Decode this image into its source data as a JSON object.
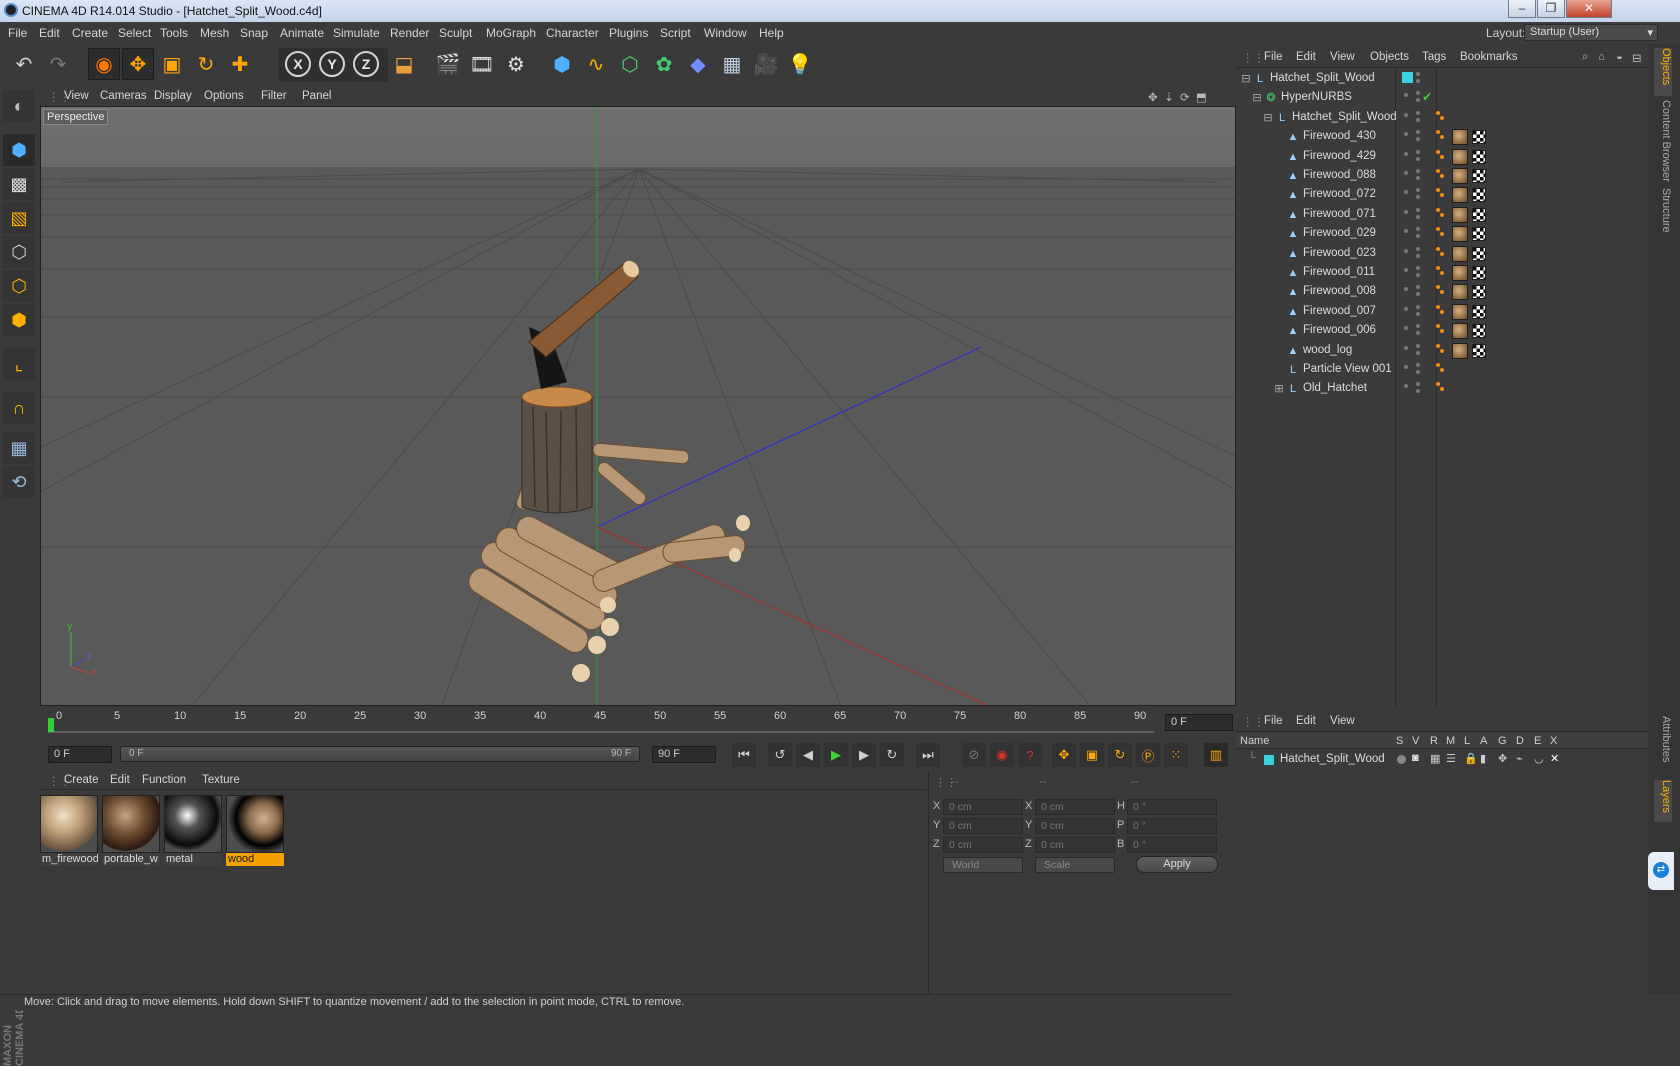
{
  "window": {
    "title": "CINEMA 4D R14.014 Studio - [Hatchet_Split_Wood.c4d]"
  },
  "menubar": {
    "items": [
      "File",
      "Edit",
      "Create",
      "Select",
      "Tools",
      "Mesh",
      "Snap",
      "Animate",
      "Simulate",
      "Render",
      "Sculpt",
      "MoGraph",
      "Character",
      "Plugins",
      "Script",
      "Window",
      "Help"
    ],
    "layout_label": "Layout:",
    "layout_value": "Startup (User)"
  },
  "toolbar": {
    "icons": [
      "undo-icon",
      "redo-icon",
      "live-selection-icon",
      "move-icon",
      "scale-icon",
      "rotate-icon",
      "create-object-icon",
      "x-axis-lock",
      "y-axis-lock",
      "z-axis-lock",
      "world-coordinates-icon",
      "render-view-icon",
      "render-picture-viewer-icon",
      "render-settings-icon",
      "cube-object-icon",
      "spline-icon",
      "nurbs-icon",
      "array-icon",
      "deformer-icon",
      "floor-icon",
      "camera-icon",
      "light-icon"
    ],
    "axis_x": "X",
    "axis_y": "Y",
    "axis_z": "Z"
  },
  "viewport": {
    "menu": [
      "View",
      "Cameras",
      "Display",
      "Options",
      "Filter",
      "Panel"
    ],
    "label": "Perspective"
  },
  "timeline": {
    "ticks": [
      "0",
      "5",
      "10",
      "15",
      "20",
      "25",
      "30",
      "35",
      "40",
      "45",
      "50",
      "55",
      "60",
      "65",
      "70",
      "75",
      "80",
      "85",
      "90"
    ],
    "current_frame": "0 F"
  },
  "transport": {
    "start": "0 F",
    "slider_left": "0 F",
    "slider_right": "90 F",
    "end": "90 F"
  },
  "materials": {
    "menu": [
      "Create",
      "Edit",
      "Function",
      "Texture"
    ],
    "items": [
      {
        "name": "m_firewood"
      },
      {
        "name": "portable_w"
      },
      {
        "name": "metal"
      },
      {
        "name": "wood"
      }
    ]
  },
  "coordinates": {
    "header": [
      "--",
      "--",
      "--"
    ],
    "rows": [
      {
        "a": "X",
        "av": "0 cm",
        "b": "X",
        "bv": "0 cm",
        "c": "H",
        "cv": "0 °"
      },
      {
        "a": "Y",
        "av": "0 cm",
        "b": "Y",
        "bv": "0 cm",
        "c": "P",
        "cv": "0 °"
      },
      {
        "a": "Z",
        "av": "0 cm",
        "b": "Z",
        "bv": "0 cm",
        "c": "B",
        "cv": "0 °"
      }
    ],
    "mode": "World",
    "scale": "Scale",
    "apply": "Apply"
  },
  "status": "Move: Click and drag to move elements. Hold down SHIFT to quantize movement / add to the selection in point mode, CTRL to remove.",
  "objects": {
    "menu": [
      "File",
      "Edit",
      "View",
      "Objects",
      "Tags",
      "Bookmarks"
    ],
    "rows": [
      {
        "name": "Hatchet_Split_Wood",
        "indent": 0,
        "icon": "null-icon"
      },
      {
        "name": "HyperNURBS",
        "indent": 1,
        "icon": "hypernurbs-icon"
      },
      {
        "name": "Hatchet_Split_Wood",
        "indent": 2,
        "icon": "null-icon"
      },
      {
        "name": "Firewood_430",
        "indent": 3,
        "icon": "polygon-icon"
      },
      {
        "name": "Firewood_429",
        "indent": 3,
        "icon": "polygon-icon"
      },
      {
        "name": "Firewood_088",
        "indent": 3,
        "icon": "polygon-icon"
      },
      {
        "name": "Firewood_072",
        "indent": 3,
        "icon": "polygon-icon"
      },
      {
        "name": "Firewood_071",
        "indent": 3,
        "icon": "polygon-icon"
      },
      {
        "name": "Firewood_029",
        "indent": 3,
        "icon": "polygon-icon"
      },
      {
        "name": "Firewood_023",
        "indent": 3,
        "icon": "polygon-icon"
      },
      {
        "name": "Firewood_011",
        "indent": 3,
        "icon": "polygon-icon"
      },
      {
        "name": "Firewood_008",
        "indent": 3,
        "icon": "polygon-icon"
      },
      {
        "name": "Firewood_007",
        "indent": 3,
        "icon": "polygon-icon"
      },
      {
        "name": "Firewood_006",
        "indent": 3,
        "icon": "polygon-icon"
      },
      {
        "name": "wood_log",
        "indent": 3,
        "icon": "polygon-icon"
      },
      {
        "name": "Particle View 001",
        "indent": 3,
        "icon": "null-icon"
      },
      {
        "name": "Old_Hatchet",
        "indent": 3,
        "icon": "null-icon"
      }
    ]
  },
  "side_tabs": [
    "Objects",
    "Content Browser",
    "Structure",
    "Attributes",
    "Layers"
  ],
  "layers": {
    "menu": [
      "File",
      "Edit",
      "View"
    ],
    "columns": [
      "Name",
      "S",
      "V",
      "R",
      "M",
      "L",
      "A",
      "G",
      "D",
      "E",
      "X"
    ],
    "row": "Hatchet_Split_Wood"
  }
}
